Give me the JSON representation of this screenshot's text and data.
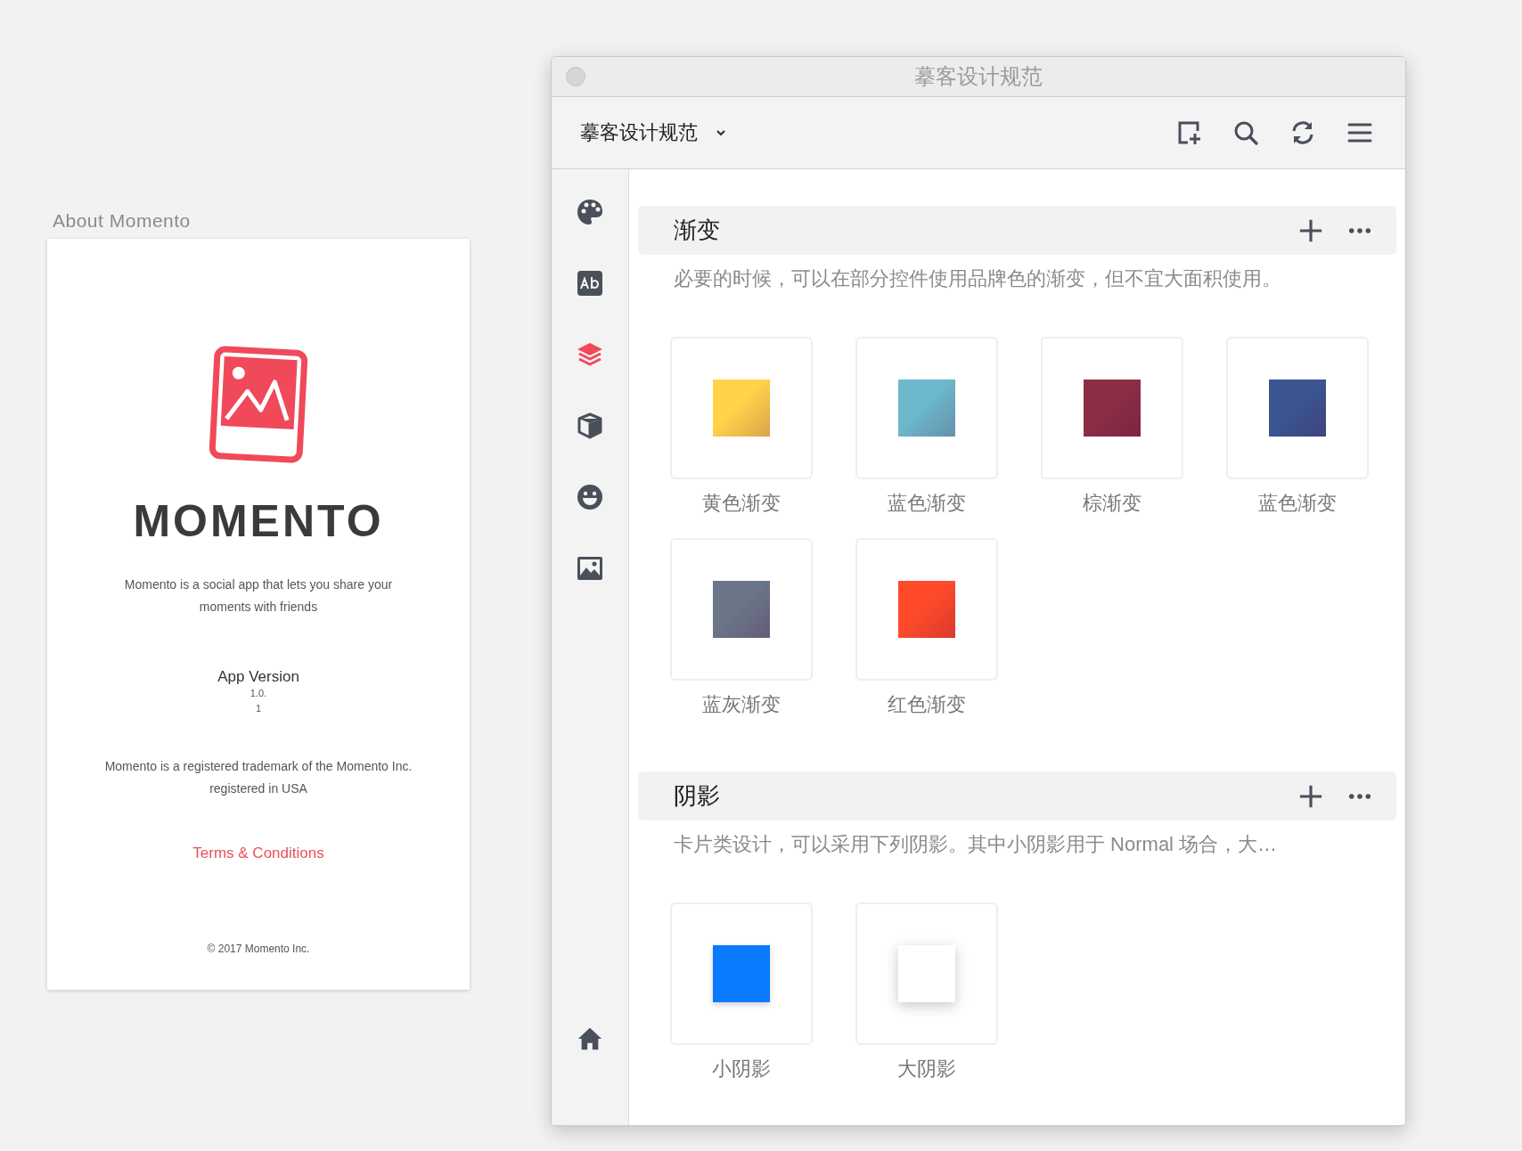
{
  "about_panel": {
    "heading": "About Momento",
    "app_name": "MOMENTO",
    "description": "Momento is a social app that lets you share your moments with friends",
    "version_label": "App Version",
    "version_lines": [
      "1.0.",
      "1"
    ],
    "trademark": "Momento is a registered trademark of the Momento Inc. registered in USA",
    "terms_link": "Terms & Conditions",
    "copyright": "© 2017 Momento Inc."
  },
  "window": {
    "title": "摹客设计规范"
  },
  "toolbar": {
    "project": "摹客设计规范"
  },
  "sidebar": {
    "items": [
      {
        "kind": "palette",
        "selected": false
      },
      {
        "kind": "text",
        "selected": false
      },
      {
        "kind": "layers",
        "selected": true
      },
      {
        "kind": "cube",
        "selected": false
      },
      {
        "kind": "emoji",
        "selected": false
      },
      {
        "kind": "image",
        "selected": false
      }
    ]
  },
  "sections": [
    {
      "title": "渐变",
      "description": "必要的时候，可以在部分控件使用品牌色的渐变，但不宜大面积使用。",
      "items": [
        {
          "kind": "gradient",
          "label": "黄色渐变",
          "color": "#ffd24a"
        },
        {
          "kind": "gradient",
          "label": "蓝色渐变",
          "color": "#6cb8cc"
        },
        {
          "kind": "gradient",
          "label": "棕渐变",
          "color": "#8a2e45"
        },
        {
          "kind": "gradient",
          "label": "蓝色渐变",
          "color": "#3a5590"
        },
        {
          "kind": "gradient",
          "label": "蓝灰渐变",
          "color": "#6a7688"
        },
        {
          "kind": "gradient",
          "label": "红色渐变",
          "color": "#ff4a2a"
        }
      ]
    },
    {
      "title": "阴影",
      "description": "卡片类设计，可以采用下列阴影。其中小阴影用于 Normal 场合，大…",
      "items": [
        {
          "kind": "small_shadow",
          "label": "小阴影",
          "color": "#0a7aff"
        },
        {
          "kind": "large_shadow",
          "label": "大阴影",
          "color": "#ffffff"
        }
      ]
    }
  ]
}
